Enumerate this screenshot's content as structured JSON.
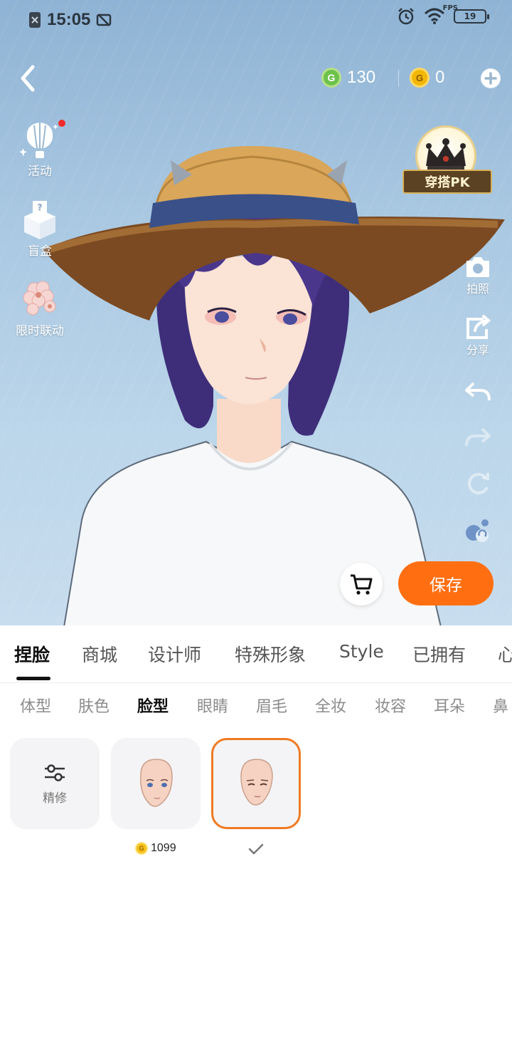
{
  "status_bar": {
    "time": "15:05",
    "fps_label": "FPS",
    "battery": "19"
  },
  "header": {
    "currency_g": "130",
    "currency_coin": "0",
    "coin_symbol": "G"
  },
  "left_menu": {
    "activity": "活动",
    "blind_box": "盲盒",
    "blind_box_mark": "?",
    "limited_collab": "限时联动"
  },
  "right_menu": {
    "pk_label": "穿搭PK",
    "photo": "拍照",
    "share": "分享"
  },
  "actions": {
    "save": "保存"
  },
  "tabs": [
    {
      "label": "捏脸",
      "active": true
    },
    {
      "label": "商城"
    },
    {
      "label": "设计师"
    },
    {
      "label": "特殊形象"
    },
    {
      "label": "Style"
    },
    {
      "label": "已拥有"
    },
    {
      "label": "心"
    }
  ],
  "subtabs": [
    {
      "label": "体型"
    },
    {
      "label": "肤色"
    },
    {
      "label": "脸型",
      "active": true
    },
    {
      "label": "眼睛"
    },
    {
      "label": "眉毛"
    },
    {
      "label": "全妆"
    },
    {
      "label": "妆容"
    },
    {
      "label": "耳朵"
    },
    {
      "label": "鼻"
    }
  ],
  "items": {
    "refine_label": "精修",
    "face1_price": "1099",
    "face2_status": "owned"
  },
  "colors": {
    "accent": "#ff6f12",
    "selected_border": "#f07a22",
    "sky": "#a9c8e2"
  }
}
